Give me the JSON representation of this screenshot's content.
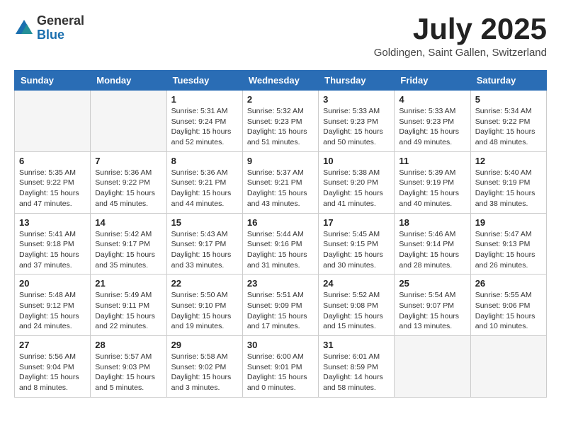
{
  "logo": {
    "general": "General",
    "blue": "Blue"
  },
  "title": "July 2025",
  "subtitle": "Goldingen, Saint Gallen, Switzerland",
  "weekdays": [
    "Sunday",
    "Monday",
    "Tuesday",
    "Wednesday",
    "Thursday",
    "Friday",
    "Saturday"
  ],
  "weeks": [
    [
      {
        "day": "",
        "info": ""
      },
      {
        "day": "",
        "info": ""
      },
      {
        "day": "1",
        "info": "Sunrise: 5:31 AM\nSunset: 9:24 PM\nDaylight: 15 hours\nand 52 minutes."
      },
      {
        "day": "2",
        "info": "Sunrise: 5:32 AM\nSunset: 9:23 PM\nDaylight: 15 hours\nand 51 minutes."
      },
      {
        "day": "3",
        "info": "Sunrise: 5:33 AM\nSunset: 9:23 PM\nDaylight: 15 hours\nand 50 minutes."
      },
      {
        "day": "4",
        "info": "Sunrise: 5:33 AM\nSunset: 9:23 PM\nDaylight: 15 hours\nand 49 minutes."
      },
      {
        "day": "5",
        "info": "Sunrise: 5:34 AM\nSunset: 9:22 PM\nDaylight: 15 hours\nand 48 minutes."
      }
    ],
    [
      {
        "day": "6",
        "info": "Sunrise: 5:35 AM\nSunset: 9:22 PM\nDaylight: 15 hours\nand 47 minutes."
      },
      {
        "day": "7",
        "info": "Sunrise: 5:36 AM\nSunset: 9:22 PM\nDaylight: 15 hours\nand 45 minutes."
      },
      {
        "day": "8",
        "info": "Sunrise: 5:36 AM\nSunset: 9:21 PM\nDaylight: 15 hours\nand 44 minutes."
      },
      {
        "day": "9",
        "info": "Sunrise: 5:37 AM\nSunset: 9:21 PM\nDaylight: 15 hours\nand 43 minutes."
      },
      {
        "day": "10",
        "info": "Sunrise: 5:38 AM\nSunset: 9:20 PM\nDaylight: 15 hours\nand 41 minutes."
      },
      {
        "day": "11",
        "info": "Sunrise: 5:39 AM\nSunset: 9:19 PM\nDaylight: 15 hours\nand 40 minutes."
      },
      {
        "day": "12",
        "info": "Sunrise: 5:40 AM\nSunset: 9:19 PM\nDaylight: 15 hours\nand 38 minutes."
      }
    ],
    [
      {
        "day": "13",
        "info": "Sunrise: 5:41 AM\nSunset: 9:18 PM\nDaylight: 15 hours\nand 37 minutes."
      },
      {
        "day": "14",
        "info": "Sunrise: 5:42 AM\nSunset: 9:17 PM\nDaylight: 15 hours\nand 35 minutes."
      },
      {
        "day": "15",
        "info": "Sunrise: 5:43 AM\nSunset: 9:17 PM\nDaylight: 15 hours\nand 33 minutes."
      },
      {
        "day": "16",
        "info": "Sunrise: 5:44 AM\nSunset: 9:16 PM\nDaylight: 15 hours\nand 31 minutes."
      },
      {
        "day": "17",
        "info": "Sunrise: 5:45 AM\nSunset: 9:15 PM\nDaylight: 15 hours\nand 30 minutes."
      },
      {
        "day": "18",
        "info": "Sunrise: 5:46 AM\nSunset: 9:14 PM\nDaylight: 15 hours\nand 28 minutes."
      },
      {
        "day": "19",
        "info": "Sunrise: 5:47 AM\nSunset: 9:13 PM\nDaylight: 15 hours\nand 26 minutes."
      }
    ],
    [
      {
        "day": "20",
        "info": "Sunrise: 5:48 AM\nSunset: 9:12 PM\nDaylight: 15 hours\nand 24 minutes."
      },
      {
        "day": "21",
        "info": "Sunrise: 5:49 AM\nSunset: 9:11 PM\nDaylight: 15 hours\nand 22 minutes."
      },
      {
        "day": "22",
        "info": "Sunrise: 5:50 AM\nSunset: 9:10 PM\nDaylight: 15 hours\nand 19 minutes."
      },
      {
        "day": "23",
        "info": "Sunrise: 5:51 AM\nSunset: 9:09 PM\nDaylight: 15 hours\nand 17 minutes."
      },
      {
        "day": "24",
        "info": "Sunrise: 5:52 AM\nSunset: 9:08 PM\nDaylight: 15 hours\nand 15 minutes."
      },
      {
        "day": "25",
        "info": "Sunrise: 5:54 AM\nSunset: 9:07 PM\nDaylight: 15 hours\nand 13 minutes."
      },
      {
        "day": "26",
        "info": "Sunrise: 5:55 AM\nSunset: 9:06 PM\nDaylight: 15 hours\nand 10 minutes."
      }
    ],
    [
      {
        "day": "27",
        "info": "Sunrise: 5:56 AM\nSunset: 9:04 PM\nDaylight: 15 hours\nand 8 minutes."
      },
      {
        "day": "28",
        "info": "Sunrise: 5:57 AM\nSunset: 9:03 PM\nDaylight: 15 hours\nand 5 minutes."
      },
      {
        "day": "29",
        "info": "Sunrise: 5:58 AM\nSunset: 9:02 PM\nDaylight: 15 hours\nand 3 minutes."
      },
      {
        "day": "30",
        "info": "Sunrise: 6:00 AM\nSunset: 9:01 PM\nDaylight: 15 hours\nand 0 minutes."
      },
      {
        "day": "31",
        "info": "Sunrise: 6:01 AM\nSunset: 8:59 PM\nDaylight: 14 hours\nand 58 minutes."
      },
      {
        "day": "",
        "info": ""
      },
      {
        "day": "",
        "info": ""
      }
    ]
  ]
}
